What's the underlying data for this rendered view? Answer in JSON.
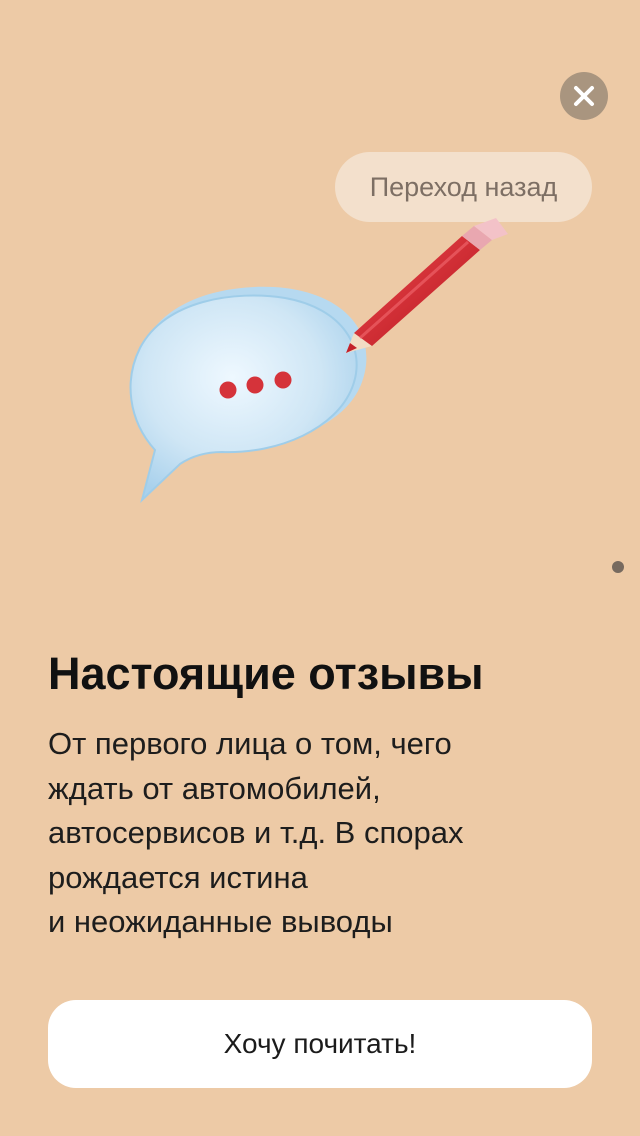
{
  "colors": {
    "background": "#edcaa6",
    "close_button_bg": "#a9957f",
    "back_pill_bg": "#f3e0cc",
    "cta_bg": "#ffffff",
    "bubble": "#cfe6f5",
    "dots": "#d5333a",
    "pencil": "#d8262f"
  },
  "icons": {
    "close": "close-icon",
    "illustration": "speech-bubble-with-pencil",
    "pager": "page-indicator-dot"
  },
  "back_button": {
    "label": "Переход назад"
  },
  "content": {
    "title": "Настоящие отзывы",
    "description_lines": [
      "От первого лица о том, чего",
      "ждать от автомобилей,",
      "автосервисов и т.д. В спорах",
      "рождается истина",
      "и неожиданные выводы"
    ]
  },
  "cta": {
    "label": "Хочу почитать!"
  }
}
